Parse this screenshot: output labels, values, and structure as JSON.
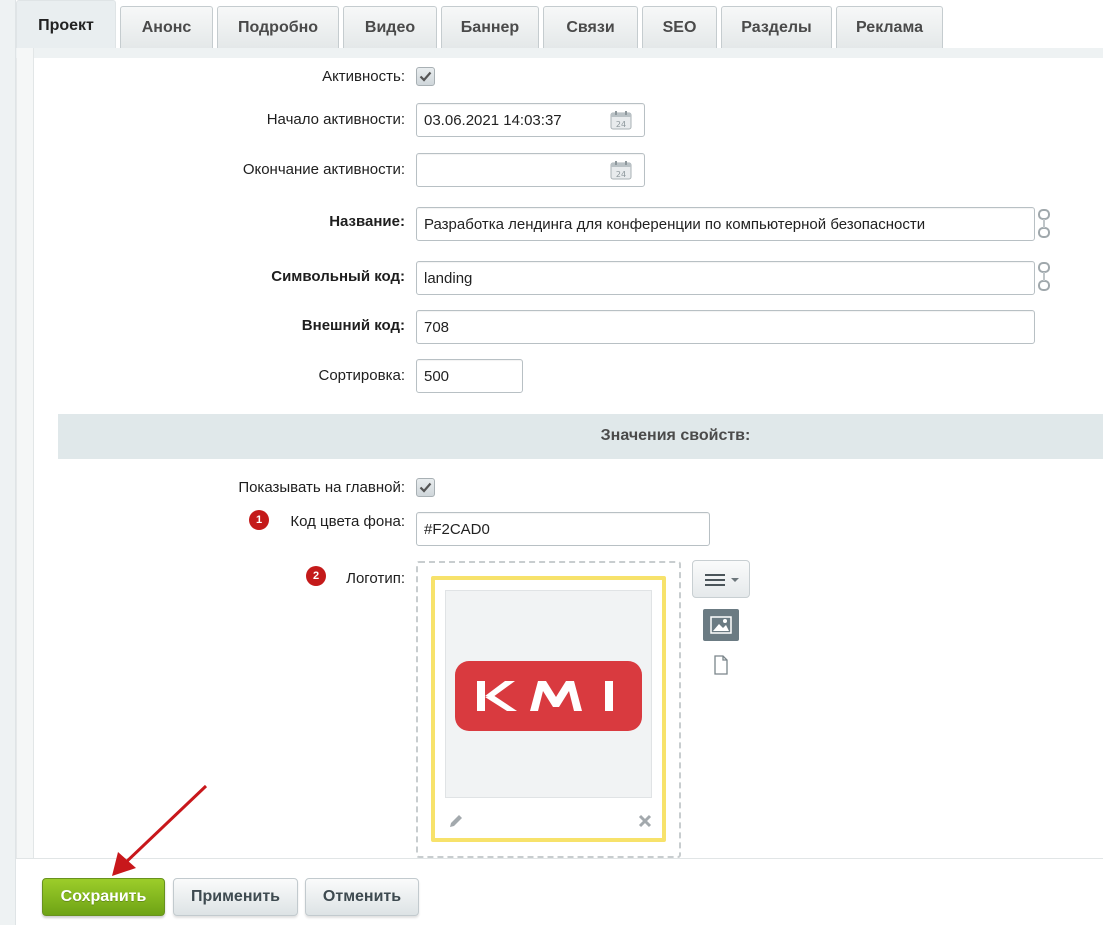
{
  "tabs": [
    {
      "label": "Проект",
      "active": true
    },
    {
      "label": "Анонс"
    },
    {
      "label": "Подробно"
    },
    {
      "label": "Видео"
    },
    {
      "label": "Баннер"
    },
    {
      "label": "Связи"
    },
    {
      "label": "SEO"
    },
    {
      "label": "Разделы"
    },
    {
      "label": "Реклама"
    }
  ],
  "form": {
    "active_label": "Активность:",
    "active_checked": true,
    "start_label": "Начало активности:",
    "start_value": "03.06.2021 14:03:37",
    "end_label": "Окончание активности:",
    "end_value": "",
    "name_label": "Название:",
    "name_value": "Разработка лендинга для конференции по компьютерной безопасности",
    "code_label": "Символьный код:",
    "code_value": "landing",
    "xml_label": "Внешний код:",
    "xml_value": "708",
    "sort_label": "Сортировка:",
    "sort_value": "500"
  },
  "properties": {
    "section_title": "Значения свойств:",
    "show_main_label": "Показывать на главной:",
    "show_main_checked": true,
    "bg_badge": "1",
    "bg_label": "Код цвета фона:",
    "bg_value": "#F2CAD0",
    "logo_badge": "2",
    "logo_label": "Логотип:",
    "logo_text": "KMI",
    "logo_color": "#d93a3f",
    "icons": [
      "calendar-icon",
      "link-icon",
      "menu-icon",
      "image-icon",
      "file-icon",
      "edit-icon",
      "close-icon"
    ]
  },
  "buttons": {
    "save": "Сохранить",
    "apply": "Применить",
    "cancel": "Отменить"
  },
  "colors": {
    "save_green": "#7fb51d",
    "arrow_red": "#c8171b",
    "badge_red": "#c41a1a",
    "section_bg": "#e0e8ea"
  }
}
